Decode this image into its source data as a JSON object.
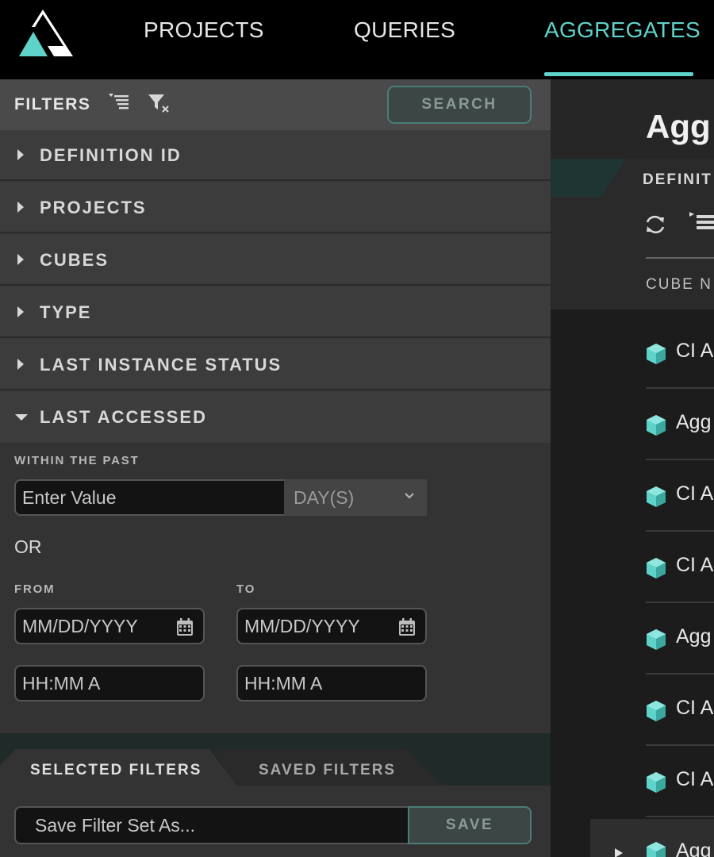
{
  "nav": {
    "items": [
      {
        "label": "PROJECTS"
      },
      {
        "label": "QUERIES"
      },
      {
        "label": "AGGREGATES"
      }
    ],
    "active": "AGGREGATES"
  },
  "filters": {
    "title": "FILTERS",
    "search_label": "SEARCH",
    "sections": [
      {
        "label": "DEFINITION ID",
        "expanded": false
      },
      {
        "label": "PROJECTS",
        "expanded": false
      },
      {
        "label": "CUBES",
        "expanded": false
      },
      {
        "label": "TYPE",
        "expanded": false
      },
      {
        "label": "LAST INSTANCE STATUS",
        "expanded": false
      },
      {
        "label": "LAST ACCESSED",
        "expanded": true
      }
    ],
    "last_accessed": {
      "within_label": "WITHIN THE PAST",
      "value_placeholder": "Enter Value",
      "unit": "DAY(S)",
      "or_label": "OR",
      "from_label": "FROM",
      "to_label": "TO",
      "date_placeholder": "MM/DD/YYYY",
      "time_placeholder": "HH:MM A"
    },
    "bottom_tabs": {
      "selected": "SELECTED FILTERS",
      "saved": "SAVED FILTERS"
    },
    "save_placeholder": "Save Filter Set As...",
    "save_label": "SAVE"
  },
  "main": {
    "title": "Agg",
    "tab_label": "DEFINIT",
    "column_header": "CUBE N",
    "rows": [
      {
        "name": "CI A"
      },
      {
        "name": "Agg"
      },
      {
        "name": "CI A"
      },
      {
        "name": "CI A"
      },
      {
        "name": "Agg"
      },
      {
        "name": "CI A"
      },
      {
        "name": "CI A"
      },
      {
        "name": "Agg"
      }
    ]
  },
  "colors": {
    "accent": "#5fd3c9",
    "background": "#1b1b1b",
    "panel": "#3a3a3a"
  },
  "icons": [
    "logo",
    "sort-filter-icon",
    "clear-filter-icon",
    "caret-right-icon",
    "caret-down-icon",
    "chevron-down-icon",
    "calendar-icon",
    "chevron-left-icon",
    "refresh-icon",
    "list-icon",
    "cube-icon"
  ]
}
